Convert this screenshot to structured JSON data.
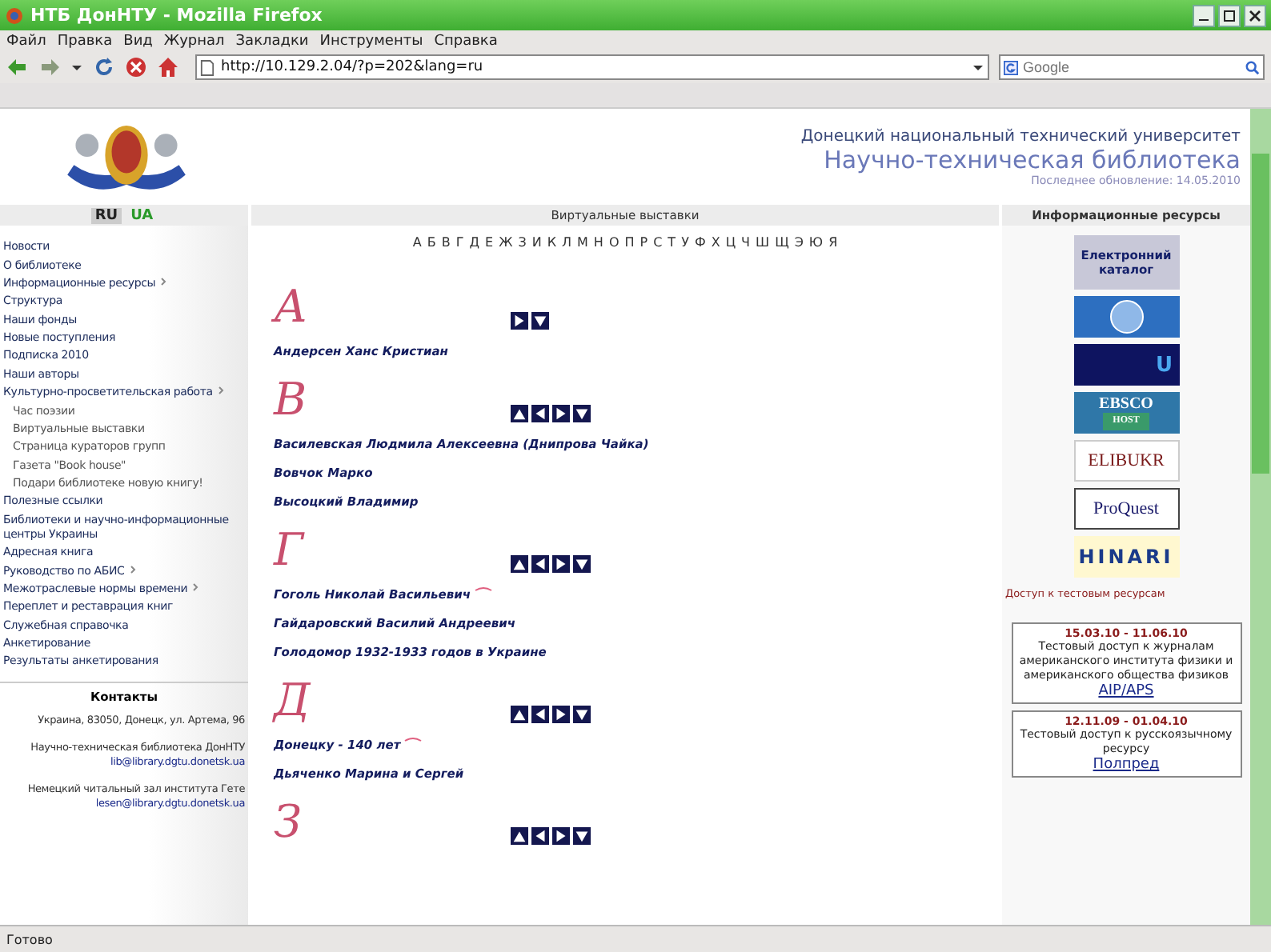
{
  "window": {
    "title": "НТБ ДонНТУ - Mozilla Firefox"
  },
  "menu": [
    "Файл",
    "Правка",
    "Вид",
    "Журнал",
    "Закладки",
    "Инструменты",
    "Справка"
  ],
  "toolbar": {
    "url": "http://10.129.2.04/?p=202&lang=ru",
    "search_placeholder": "Google"
  },
  "header": {
    "university": "Донецкий национальный технический университет",
    "library": "Научно-техническая библиотека",
    "updated": "Последнее обновление: 14.05.2010"
  },
  "languages": [
    {
      "label": "RU",
      "selected": true
    },
    {
      "label": "UA",
      "selected": false
    }
  ],
  "columns": {
    "center": "Виртуальные выставки",
    "right": "Информационные ресурсы"
  },
  "nav": [
    {
      "label": "Новости",
      "submenu": false
    },
    {
      "label": "О библиотеке",
      "submenu": false
    },
    {
      "label": "Информационные ресурсы",
      "submenu": true
    },
    {
      "label": "Структура",
      "submenu": false
    },
    {
      "label": "Наши фонды",
      "submenu": false
    },
    {
      "label": "Новые поступления",
      "submenu": false
    },
    {
      "label": "Подписка 2010",
      "submenu": false
    },
    {
      "label": "Наши авторы",
      "submenu": false
    },
    {
      "label": "Культурно-просветительская работа",
      "submenu": true,
      "children": [
        {
          "label": "Час поэзии"
        },
        {
          "label": "Виртуальные выставки"
        },
        {
          "label": "Страница кураторов групп"
        },
        {
          "label": "Газета \"Book house\""
        },
        {
          "label": "Подари библиотеке новую книгу!"
        }
      ]
    },
    {
      "label": "Полезные ссылки",
      "submenu": false
    },
    {
      "label": "Библиотеки и научно-информационные центры Украины",
      "submenu": false
    },
    {
      "label": "Адресная книга",
      "submenu": false
    },
    {
      "label": "Руководство по АБИС",
      "submenu": true
    },
    {
      "label": "Межотраслевые нормы времени",
      "submenu": true
    },
    {
      "label": "Переплет и реставрация книг",
      "submenu": false
    },
    {
      "label": "Служебная справочка",
      "submenu": false
    },
    {
      "label": "Анкетирование",
      "submenu": false
    },
    {
      "label": "Результаты анкетирования",
      "submenu": false
    }
  ],
  "contacts": {
    "title": "Контакты",
    "address": "Украина, 83050, Донецк, ул. Артема, 96",
    "org1": "Научно-техническая библиотека ДонНТУ",
    "email1": "lib@library.dgtu.donetsk.ua",
    "org2": "Немецкий читальный зал института Гете",
    "email2": "lesen@library.dgtu.donetsk.ua"
  },
  "alphabet": [
    "А",
    "Б",
    "В",
    "Г",
    "Д",
    "Е",
    "Ж",
    "З",
    "И",
    "К",
    "Л",
    "М",
    "Н",
    "О",
    "П",
    "Р",
    "С",
    "Т",
    "У",
    "Ф",
    "Х",
    "Ц",
    "Ч",
    "Ш",
    "Щ",
    "Э",
    "Ю",
    "Я"
  ],
  "sections": [
    {
      "letter": "А",
      "buttons": [
        {
          "kind": "right"
        },
        {
          "kind": "down"
        }
      ],
      "items": [
        {
          "title": "Андерсен Ханс Кристиан",
          "new": false
        }
      ]
    },
    {
      "letter": "В",
      "buttons": [
        {
          "kind": "up"
        },
        {
          "kind": "left"
        },
        {
          "kind": "right"
        },
        {
          "kind": "down"
        }
      ],
      "items": [
        {
          "title": "Василевская Людмила Алексеевна (Днипрова Чайка)",
          "new": false
        },
        {
          "title": "Вовчок Марко",
          "new": false
        },
        {
          "title": "Высоцкий Владимир",
          "new": false
        }
      ]
    },
    {
      "letter": "Г",
      "buttons": [
        {
          "kind": "up"
        },
        {
          "kind": "left"
        },
        {
          "kind": "right"
        },
        {
          "kind": "down"
        }
      ],
      "items": [
        {
          "title": "Гоголь Николай Васильевич",
          "new": true
        },
        {
          "title": "Гайдаровский Василий Андреевич",
          "new": false
        },
        {
          "title": "Голодомор 1932-1933 годов в Украине",
          "new": false
        }
      ]
    },
    {
      "letter": "Д",
      "buttons": [
        {
          "kind": "up"
        },
        {
          "kind": "left"
        },
        {
          "kind": "right"
        },
        {
          "kind": "down"
        }
      ],
      "items": [
        {
          "title": "Донецку - 140 лет",
          "new": true
        },
        {
          "title": "Дьяченко Марина и Сергей",
          "new": false
        }
      ]
    },
    {
      "letter": "З",
      "buttons": [
        {
          "kind": "up"
        },
        {
          "kind": "left"
        },
        {
          "kind": "right"
        },
        {
          "kind": "down"
        }
      ]
    }
  ],
  "resources": [
    {
      "kind": "catalog",
      "text": "Електронний каталог"
    },
    {
      "kind": "globe"
    },
    {
      "kind": "u",
      "text": "U"
    },
    {
      "kind": "ebsco",
      "text": "EBSCO",
      "sub": "HOST"
    },
    {
      "kind": "elib",
      "text": "ELIBUKR"
    },
    {
      "kind": "proquest",
      "text": "ProQuest"
    },
    {
      "kind": "hinari",
      "text": "HINARI"
    }
  ],
  "test_access": {
    "title": "Доступ к тестовым ресурсам",
    "notices": [
      {
        "dates": "15.03.10 - 11.06.10",
        "text": "Тестовый доступ к журналам американского института физики и американского общества физиков",
        "link": "AIP/APS"
      },
      {
        "dates": "12.11.09 - 01.04.10",
        "text": "Тестовый доступ к русскоязычному ресурсу",
        "link": "Полпред"
      }
    ]
  },
  "status_bar": "Готово"
}
